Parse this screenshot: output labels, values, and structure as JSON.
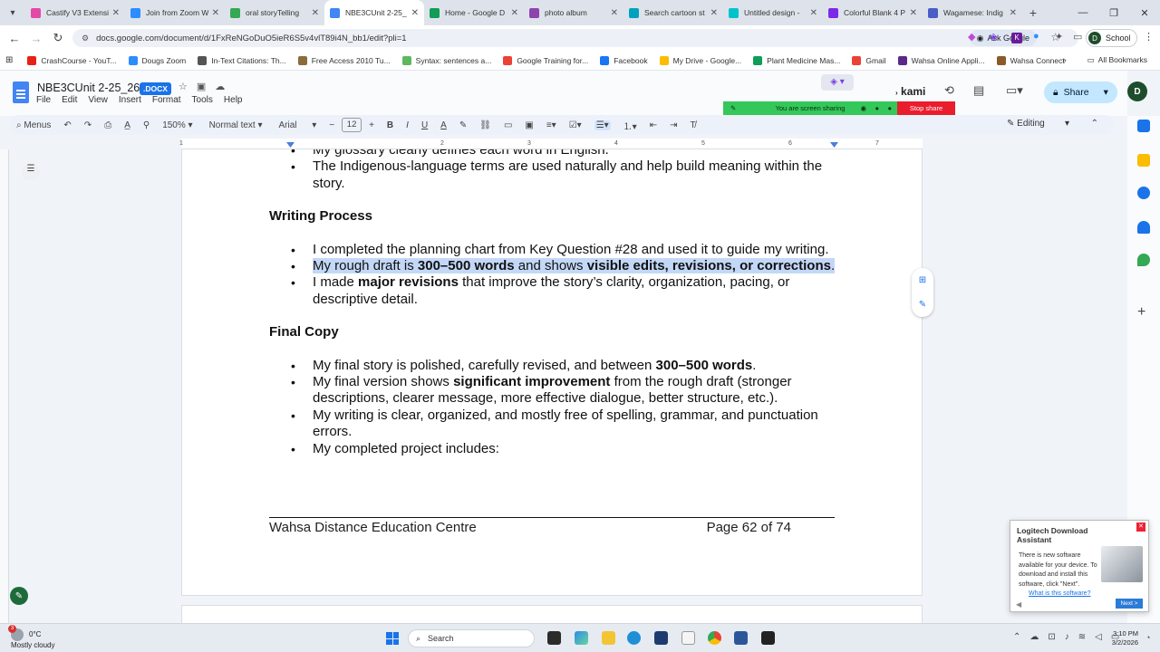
{
  "browser": {
    "tabs": [
      {
        "label": "Castify V3 Extensi",
        "color": "#e34aa8",
        "active": false
      },
      {
        "label": "Join from Zoom W",
        "color": "#2d8cff",
        "active": false
      },
      {
        "label": "oral storyTelling",
        "color": "#34a853",
        "active": false
      },
      {
        "label": "NBE3CUnit 2-25_",
        "color": "#4285f4",
        "active": true
      },
      {
        "label": "Home - Google D",
        "color": "#0f9d58",
        "active": false
      },
      {
        "label": "photo album",
        "color": "#8e44ad",
        "active": false
      },
      {
        "label": "Search cartoon st",
        "color": "#00a3bf",
        "active": false
      },
      {
        "label": "Untitled design -",
        "color": "#00c4cc",
        "active": false
      },
      {
        "label": "Colorful Blank 4 P",
        "color": "#7d2ae8",
        "active": false
      },
      {
        "label": "Wagamese: Indig",
        "color": "#4a5cc8",
        "active": false
      }
    ],
    "url": "docs.google.com/document/d/1FxReNGoDuO5ieR6S5v4vlT89i4N_bb1/edit?pli=1",
    "ask_google": "Ask Google",
    "profile_label": "School",
    "profile_initial": "D",
    "bookmarks": [
      {
        "label": "CrashCourse - YouT...",
        "color": "#e62117"
      },
      {
        "label": "Dougs Zoom",
        "color": "#2d8cff"
      },
      {
        "label": "In-Text Citations: Th...",
        "color": "#555555"
      },
      {
        "label": "Free Access 2010 Tu...",
        "color": "#8a6d3b"
      },
      {
        "label": "Syntax: sentences a...",
        "color": "#5cb85c"
      },
      {
        "label": "Google Training for...",
        "color": "#ea4335"
      },
      {
        "label": "Facebook",
        "color": "#1877f2"
      },
      {
        "label": "My Drive - Google...",
        "color": "#fbbc04"
      },
      {
        "label": "Plant Medicine Mas...",
        "color": "#0f9d58"
      },
      {
        "label": "Gmail",
        "color": "#ea4335"
      },
      {
        "label": "Wahsa Online Appli...",
        "color": "#5b2a86"
      },
      {
        "label": "Wahsa Connect",
        "color": "#8b5a2b"
      }
    ],
    "all_bookmarks": "All Bookmarks"
  },
  "docs": {
    "title": "NBE3CUnit 2-25_26",
    "ext_badge": ".DOCX",
    "menus": [
      "File",
      "Edit",
      "View",
      "Insert",
      "Format",
      "Tools",
      "Help"
    ],
    "kami": "kami",
    "share_label": "Share",
    "user_initial": "D",
    "screen_share_text": "You are screen sharing",
    "stop_share": "Stop share",
    "toolbar": {
      "menus_label": "Menus",
      "zoom": "150%",
      "style": "Normal text",
      "font": "Arial",
      "font_size": "12",
      "editing_mode": "Editing"
    },
    "ruler_ticks": [
      "1",
      "2",
      "3",
      "4",
      "5",
      "6",
      "7"
    ]
  },
  "document": {
    "top_items": [
      "My glossary clearly defines each word in English.",
      "The Indigenous-language terms are used naturally and help build meaning within the story."
    ],
    "writing_process": {
      "heading": "Writing Process",
      "item1": "I completed the planning chart from Key Question #28 and used it to guide my writing.",
      "item2_a": "My rough draft is ",
      "item2_b": "300–500 words",
      "item2_c": " and shows ",
      "item2_d": "visible edits, revisions, or corrections",
      "item2_e": ".",
      "item3_a": "I made ",
      "item3_b": "major revisions",
      "item3_c": " that improve the story’s clarity, organization, pacing, or descriptive detail."
    },
    "final_copy": {
      "heading": "Final Copy",
      "item1_a": "My final story is polished, carefully revised, and between ",
      "item1_b": "300–500 words",
      "item1_c": ".",
      "item2_a": "My final version shows ",
      "item2_b": "significant improvement",
      "item2_c": " from the rough draft (stronger descriptions, clearer message, more effective dialogue, better structure, etc.).",
      "item3": "My writing is clear, organized, and mostly free of spelling, grammar, and punctuation errors.",
      "item4": "My completed project includes:"
    },
    "footer_left": "Wahsa Distance Education Centre",
    "footer_right": "Page 62 of 74"
  },
  "popup": {
    "title": "Logitech Download Assistant",
    "body": "There is new software available for your device. To download and install this software, click \"Next\".",
    "link": "What is this software?",
    "next": "Next >"
  },
  "taskbar": {
    "weather_badge": "3",
    "temperature": "0°C",
    "condition": "Mostly cloudy",
    "search": "Search",
    "time": "3:10 PM",
    "date": "3/2/2026"
  }
}
